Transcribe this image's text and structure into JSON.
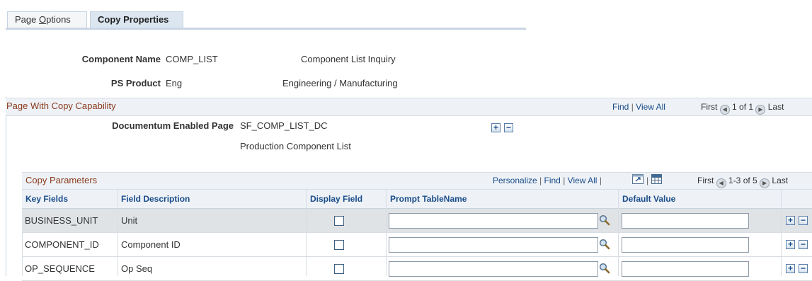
{
  "tabs": [
    {
      "label_pre": "Page ",
      "label_key": "O",
      "label_post": "ptions"
    },
    {
      "label": "Copy Properties"
    }
  ],
  "header": {
    "component_name_label": "Component Name",
    "component_name_value": "COMP_LIST",
    "component_name_desc": "Component List Inquiry",
    "ps_product_label": "PS Product",
    "ps_product_value": "Eng",
    "ps_product_desc": "Engineering / Manufacturing"
  },
  "page_group": {
    "title": "Page With Copy Capability",
    "find": "Find",
    "view_all": "View All",
    "first": "First",
    "count": "1 of 1",
    "last": "Last",
    "doc_label": "Documentum Enabled Page",
    "doc_value": "SF_COMP_LIST_DC",
    "doc_desc": "Production Component List"
  },
  "copy_params": {
    "title": "Copy Parameters",
    "personalize": "Personalize",
    "find": "Find",
    "view_all": "View All",
    "first": "First",
    "count": "1-3 of 5",
    "last": "Last",
    "columns": [
      "Key Fields",
      "Field Description",
      "Display Field",
      "Prompt TableName",
      "Default Value"
    ],
    "rows": [
      {
        "key": "BUSINESS_UNIT",
        "desc": "Unit",
        "display": false,
        "prompt": "",
        "default": ""
      },
      {
        "key": "COMPONENT_ID",
        "desc": "Component ID",
        "display": false,
        "prompt": "",
        "default": ""
      },
      {
        "key": "OP_SEQUENCE",
        "desc": "Op Seq",
        "display": false,
        "prompt": "",
        "default": ""
      }
    ]
  },
  "buttons": {
    "add": "+",
    "delete": "−"
  },
  "colors": {
    "accent": "#1a4c8a",
    "group_title": "#8a3a1d",
    "selected_row": "#e0e3e6"
  }
}
